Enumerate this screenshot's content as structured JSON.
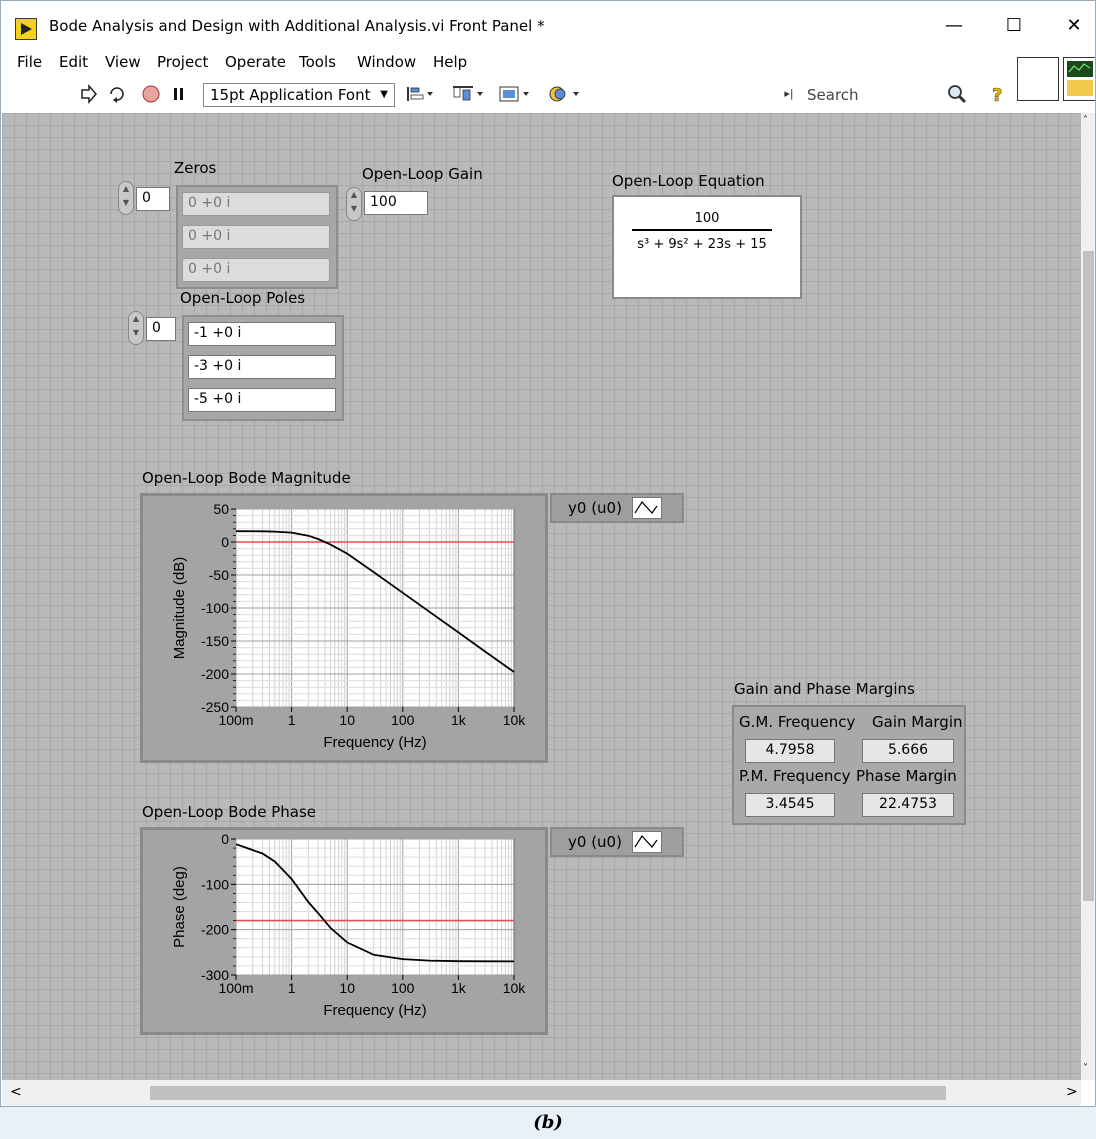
{
  "window": {
    "title": "Bode Analysis and Design with Additional Analysis.vi Front Panel *",
    "controls": {
      "minimize": "—",
      "maximize": "☐",
      "close": "✕"
    }
  },
  "menu": [
    "File",
    "Edit",
    "View",
    "Project",
    "Operate",
    "Tools",
    "Window",
    "Help"
  ],
  "toolbar": {
    "font": "15pt Application Font",
    "search_placeholder": "Search",
    "icons": [
      "run-arrow-icon",
      "run-continuously-icon",
      "abort-icon",
      "pause-icon",
      "align-icon",
      "distribute-icon",
      "resize-icon",
      "reorder-icon",
      "search-icon",
      "help-icon"
    ]
  },
  "zeros": {
    "label": "Zeros",
    "index": "0",
    "values": [
      "0 +0 i",
      "0 +0 i",
      "0 +0 i"
    ]
  },
  "gain": {
    "label": "Open-Loop Gain",
    "value": "100"
  },
  "poles": {
    "label": "Open-Loop Poles",
    "index": "0",
    "values": [
      "-1 +0 i",
      "-3 +0 i",
      "-5 +0 i"
    ]
  },
  "equation": {
    "label": "Open-Loop Equation",
    "numerator": "100",
    "denominator": "s³ + 9s² + 23s + 15"
  },
  "magnitude_plot": {
    "title": "Open-Loop Bode Magnitude",
    "legend": "y0 (u0)"
  },
  "phase_plot": {
    "title": "Open-Loop Bode Phase",
    "legend": "y0 (u0)"
  },
  "margins": {
    "label": "Gain and Phase Margins",
    "gm_freq_label": "G.M. Frequency",
    "gm_freq": "4.7958",
    "gain_margin_label": "Gain Margin",
    "gain_margin": "5.666",
    "pm_freq_label": "P.M. Frequency",
    "pm_freq": "3.4545",
    "phase_margin_label": "Phase Margin",
    "phase_margin": "22.4753"
  },
  "caption": "(b)",
  "chart_data": [
    {
      "type": "line",
      "title": "Open-Loop Bode Magnitude",
      "xlabel": "Frequency (Hz)",
      "ylabel": "Magnitude (dB)",
      "xscale": "log",
      "xlim": [
        0.1,
        10000
      ],
      "ylim": [
        -250,
        50
      ],
      "xticks": [
        "100m",
        "1",
        "10",
        "100",
        "1k",
        "10k"
      ],
      "yticks": [
        "50",
        "0",
        "-50",
        "-100",
        "-150",
        "-200",
        "-250"
      ],
      "grid": true,
      "reference_line": {
        "y": 0,
        "color": "#e05050"
      },
      "series": [
        {
          "color": "#000000",
          "x": [
            0.1,
            0.3,
            0.5,
            1,
            2,
            3,
            5,
            10,
            30,
            100,
            300,
            1000,
            3000,
            10000
          ],
          "y": [
            16.4,
            16.2,
            15.8,
            14.3,
            9.5,
            4.6,
            -3.9,
            -17.5,
            -45.6,
            -77.0,
            -105.6,
            -137.0,
            -165.7,
            -197.0
          ]
        }
      ]
    },
    {
      "type": "line",
      "title": "Open-Loop Bode Phase",
      "xlabel": "Frequency (Hz)",
      "ylabel": "Phase (deg)",
      "xscale": "log",
      "xlim": [
        0.1,
        10000
      ],
      "ylim": [
        -300,
        0
      ],
      "xticks": [
        "100m",
        "1",
        "10",
        "100",
        "1k",
        "10k"
      ],
      "yticks": [
        "0",
        "-100",
        "-200",
        "-300"
      ],
      "grid": true,
      "reference_line": {
        "y": -180,
        "color": "#e05050"
      },
      "series": [
        {
          "color": "#000000",
          "x": [
            0.1,
            0.3,
            0.5,
            1,
            2,
            3,
            5,
            10,
            30,
            100,
            300,
            1000,
            3000,
            10000
          ],
          "y": [
            -11.4,
            -32.0,
            -49.9,
            -88.2,
            -139.0,
            -163.4,
            -196.1,
            -228.0,
            -255.4,
            -265.0,
            -268.3,
            -269.5,
            -269.8,
            -270.0
          ]
        }
      ]
    }
  ]
}
